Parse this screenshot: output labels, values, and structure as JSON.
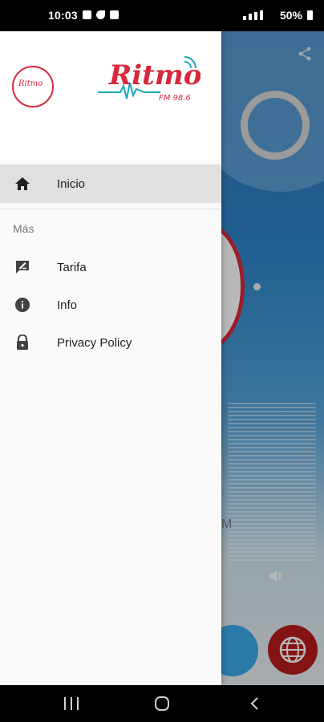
{
  "status": {
    "time": "10:03",
    "battery": "50%"
  },
  "drawer": {
    "brand": "Ritmo",
    "brand_sub": "FM 98.6",
    "items": [
      {
        "label": "Inicio",
        "icon": "home-icon",
        "active": true
      }
    ],
    "section_title": "Más",
    "more_items": [
      {
        "label": "Tarifa",
        "icon": "rate-review-icon"
      },
      {
        "label": "Info",
        "icon": "info-icon"
      },
      {
        "label": "Privacy Policy",
        "icon": "lock-icon"
      }
    ]
  },
  "background_app": {
    "partial_text": "M"
  },
  "colors": {
    "brand_red": "#d8283c",
    "brand_teal": "#1aa7b5",
    "drawer_bg": "#fafafa",
    "active_bg": "#e0e0e0"
  }
}
